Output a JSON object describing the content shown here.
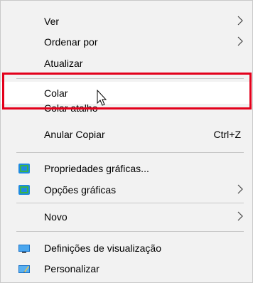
{
  "menu": {
    "items": [
      {
        "label": "Ver"
      },
      {
        "label": "Ordenar por"
      },
      {
        "label": "Atualizar"
      },
      {
        "label": "Colar"
      },
      {
        "label": "Colar atalho"
      },
      {
        "label": "Anular Copiar",
        "shortcut": "Ctrl+Z"
      },
      {
        "label": "Propriedades gráficas..."
      },
      {
        "label": "Opções gráficas"
      },
      {
        "label": "Novo"
      },
      {
        "label": "Definições de visualização"
      },
      {
        "label": "Personalizar"
      }
    ]
  },
  "colors": {
    "highlight_border": "#e3001b",
    "menu_bg": "#f2f2f2",
    "separator": "#c7c7c7"
  },
  "icons": [
    "chevron-right-icon",
    "intel-graphics-icon",
    "display-icon",
    "personalize-icon",
    "mouse-cursor-icon"
  ]
}
